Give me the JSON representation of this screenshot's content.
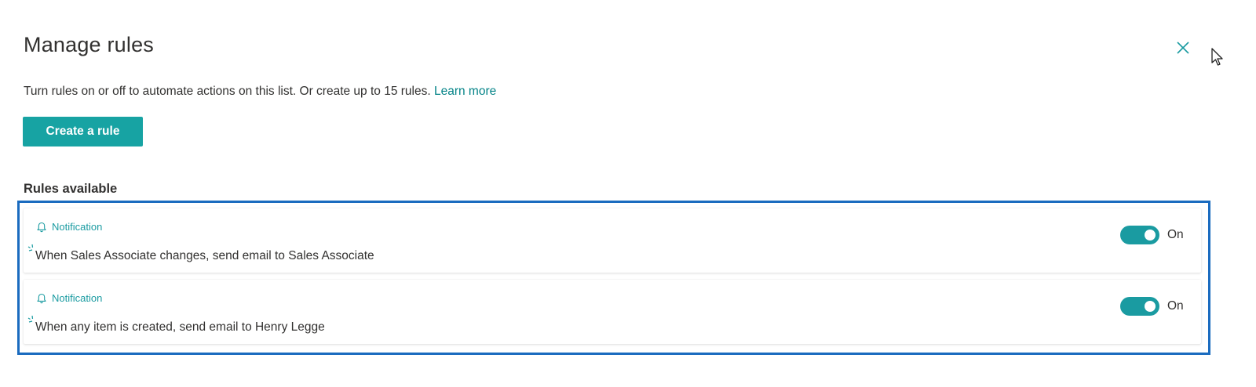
{
  "panel": {
    "title": "Manage rules",
    "description": "Turn rules on or off to automate actions on this list. Or create up to 15 rules.",
    "learn_more": "Learn more",
    "create_button": "Create a rule",
    "section_label": "Rules available"
  },
  "rules": [
    {
      "type": "Notification",
      "text": "When Sales Associate changes, send email to Sales Associate",
      "toggle_label": "On",
      "enabled": true
    },
    {
      "type": "Notification",
      "text": "When any item is created, send email to Henry Legge",
      "toggle_label": "On",
      "enabled": true
    }
  ],
  "icons": {
    "close": "close-icon",
    "rule_type": "bell-icon",
    "rule_marker": "sparkle-icon",
    "cursor": "cursor-arrow-icon"
  },
  "colors": {
    "accent": "#17a3a3",
    "link": "#038387",
    "highlight_border": "#1a6bbf",
    "text": "#323130"
  }
}
